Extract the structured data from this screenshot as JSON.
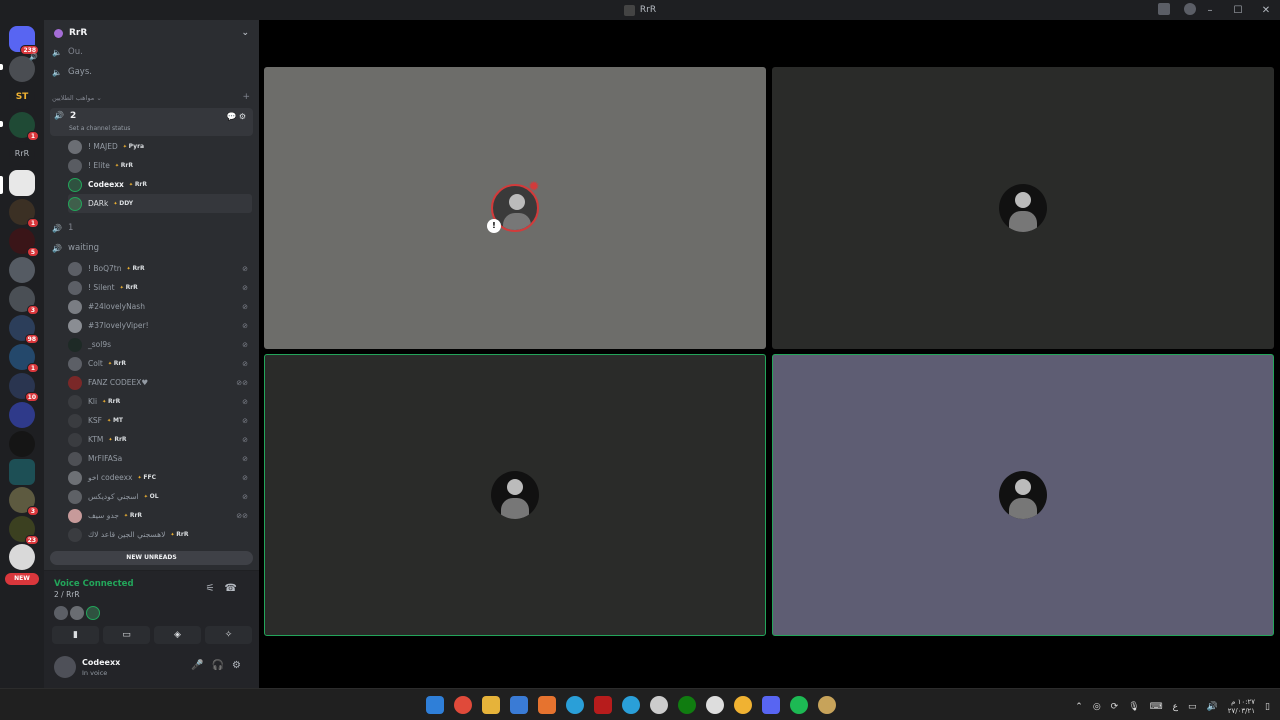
{
  "window": {
    "title": "RrR"
  },
  "rail": {
    "badges": [
      "238",
      "1",
      "1",
      "5",
      "3",
      "98",
      "1",
      "10",
      "3",
      "23"
    ],
    "new_label": "NEW"
  },
  "sidebar": {
    "guild_name": "RrR",
    "top_channels": [
      "Ou.",
      "Gays."
    ],
    "category": "مواهب الطلايين",
    "active_channel": {
      "name": "2",
      "status": "Set a channel status"
    },
    "active_users": [
      {
        "name": "! MAJED",
        "tag": "Pyra"
      },
      {
        "name": "! Elite",
        "tag": "RrR"
      },
      {
        "name": "Codeexx",
        "tag": "RrR"
      },
      {
        "name": "DARk",
        "tag": "DDY"
      }
    ],
    "channel_1": "1",
    "waiting_channel": "waiting",
    "waiting_users": [
      {
        "name": "! BoQ7tn",
        "tag": "RrR"
      },
      {
        "name": "! Silent",
        "tag": "RrR"
      },
      {
        "name": "#24lovelyNash",
        "tag": ""
      },
      {
        "name": "#37lovelyViper!",
        "tag": ""
      },
      {
        "name": "_sol9s",
        "tag": ""
      },
      {
        "name": "Colt",
        "tag": "RrR"
      },
      {
        "name": "FANZ CODEEX♥",
        "tag": ""
      },
      {
        "name": "Kli",
        "tag": "RrR"
      },
      {
        "name": "KSF",
        "tag": "MT"
      },
      {
        "name": "KTM",
        "tag": "RrR"
      },
      {
        "name": "MrFIFASa",
        "tag": ""
      },
      {
        "name": "اخو codeexx",
        "tag": "FFC"
      },
      {
        "name": "اسجني كوديكس",
        "tag": "OL"
      },
      {
        "name": "جدو سيف",
        "tag": "RrR"
      },
      {
        "name": "لاهسجني الجين قاعد لاك",
        "tag": "RrR"
      }
    ],
    "new_unreads": "NEW UNREADS"
  },
  "voice": {
    "status": "Voice Connected",
    "location": "2 / RrR"
  },
  "user": {
    "name": "Codeexx",
    "status": "In voice"
  },
  "stage": {
    "tile_names": [
      "user-tile-1",
      "user-tile-2",
      "user-tile-3",
      "user-tile-4"
    ]
  },
  "taskbar": {
    "clock_time": "١٠:٢٧ م",
    "clock_date": "٢٧/٠٣/٢١",
    "lang": "ع"
  }
}
